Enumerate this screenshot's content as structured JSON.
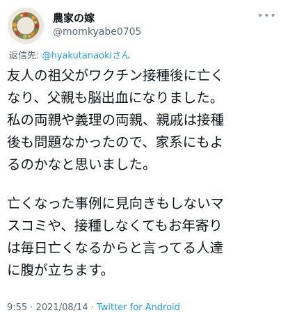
{
  "tweet": {
    "author_name": "農家の嫁",
    "author_handle": "@momkyabe0705",
    "more_icon": "•••",
    "replying_prefix": "返信先: ",
    "replying_mention": "@hyakutanaokiさん",
    "paragraph1": "友人の祖父がワクチン接種後に亡く\nなり、父親も脳出血になりました。\n私の両親や義理の両親、親戚は接種\n後も問題なかったので、家系にもよ\nるのかなと思いました。",
    "paragraph2": "亡くなった事例に見向きもしないマ\nスコミや、接種しなくてもお年寄り\nは毎日亡くなるからと言ってる人達\nに腹が立ちます。",
    "time": "9:55",
    "separator": " · ",
    "date": "2021/08/14",
    "separator2": " · ",
    "source": "Twitter for Android"
  },
  "colors": {
    "text": "#0f1419",
    "secondary": "#536471",
    "link": "#1d9bf0",
    "background": "#ffffff"
  }
}
